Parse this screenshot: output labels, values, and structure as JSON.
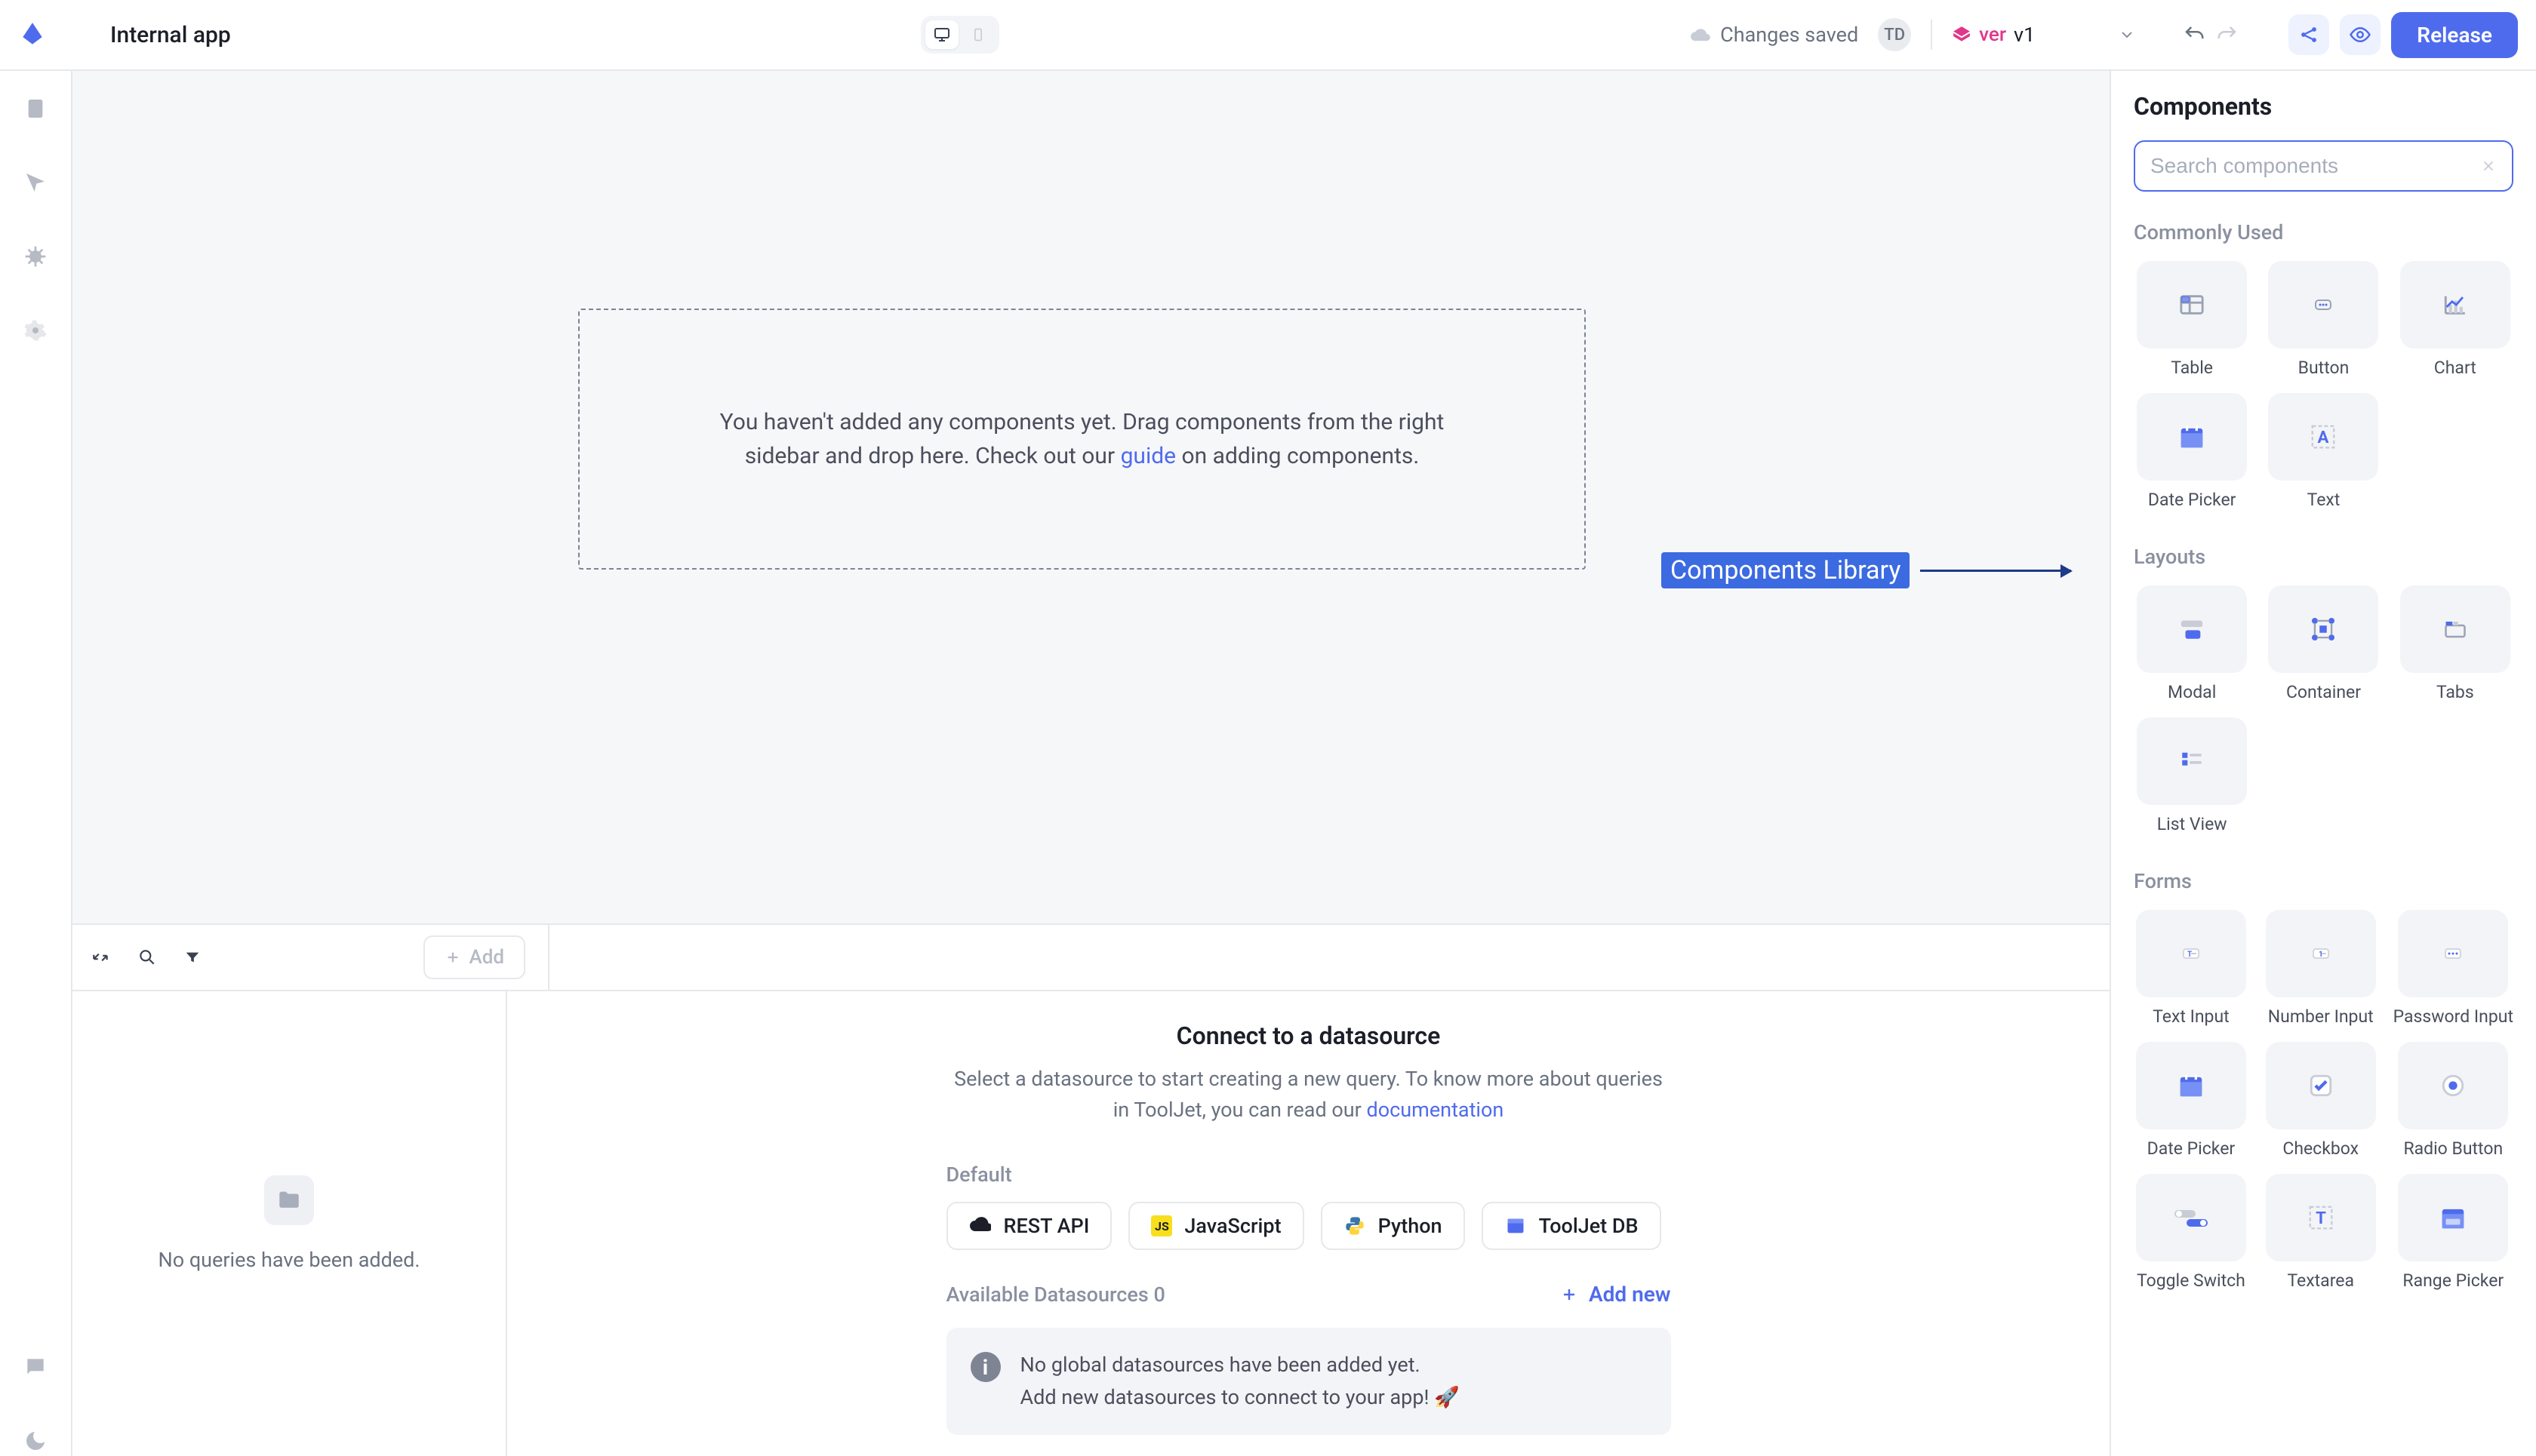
{
  "topbar": {
    "app_name": "Internal app",
    "cloud_status": "Changes saved",
    "avatar_initials": "TD",
    "ver_label": "ver",
    "ver_value": "v1",
    "release_label": "Release"
  },
  "canvas": {
    "empty_prefix": "You haven't added any components yet. Drag components from the right sidebar and drop here. Check out our ",
    "empty_link": "guide",
    "empty_suffix": " on adding components.",
    "annotation": "Components Library"
  },
  "querypanel": {
    "add_label": "Add",
    "no_queries": "No queries have been added."
  },
  "datasource": {
    "title": "Connect to a datasource",
    "desc_prefix": "Select a datasource to start creating a new query. To know more about queries in ToolJet, you can read our  ",
    "desc_link": "documentation",
    "default_label": "Default",
    "buttons": {
      "rest": "REST API",
      "js": "JavaScript",
      "python": "Python",
      "tjdb": "ToolJet DB"
    },
    "available_label": "Available Datasources 0",
    "add_new_label": "Add new",
    "info_line1": "No global datasources have been added yet.",
    "info_line2": "Add new datasources to connect to your app! 🚀"
  },
  "rightpanel": {
    "title": "Components",
    "search_placeholder": "Search components",
    "sections": {
      "common": "Commonly Used",
      "layouts": "Layouts",
      "forms": "Forms"
    },
    "common_items": [
      "Table",
      "Button",
      "Chart",
      "Date Picker",
      "Text"
    ],
    "layout_items": [
      "Modal",
      "Container",
      "Tabs",
      "List View"
    ],
    "form_items": [
      "Text Input",
      "Number Input",
      "Password Input",
      "Date Picker",
      "Checkbox",
      "Radio Button",
      "Toggle Switch",
      "Textarea",
      "Range Picker"
    ]
  }
}
